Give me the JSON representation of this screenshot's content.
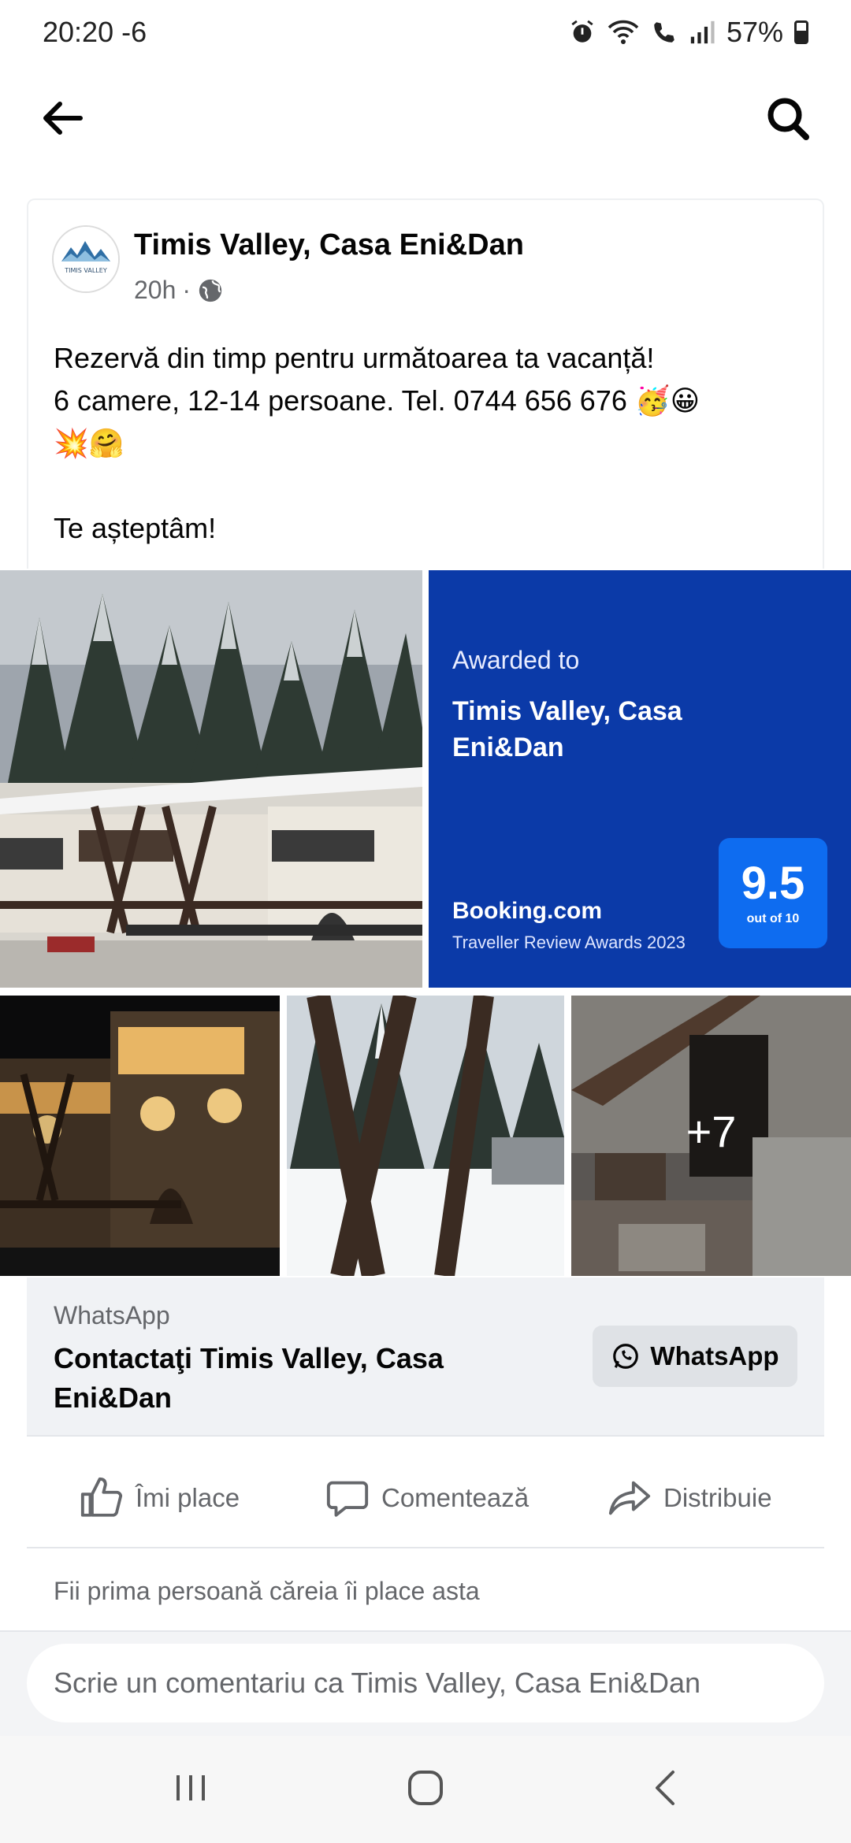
{
  "status_bar": {
    "time": "20:20",
    "extra": "-6",
    "battery": "57%"
  },
  "post": {
    "author": "Timis Valley, Casa Eni&Dan",
    "avatar_text": "TIMIS VALLEY",
    "time": "20h",
    "separator": "·",
    "text_line1": "Rezervă din timp pentru următoarea ta vacanță!",
    "text_line2": "6 camere, 12-14 persoane. Tel. 0744 656 676 🥳😀",
    "text_line3": "💥🤗",
    "text_line4": "Te așteptâm!"
  },
  "award": {
    "label": "Awarded to",
    "name": "Timis Valley, Casa Eni&Dan",
    "brand": "Booking.com",
    "subtitle": "Traveller Review Awards 2023",
    "score": "9.5",
    "score_sub": "out of 10"
  },
  "photos": {
    "more_count": "+7"
  },
  "cta": {
    "source": "WhatsApp",
    "title": "Contactaţi Timis Valley, Casa Eni&Dan",
    "button": "WhatsApp"
  },
  "actions": {
    "like": "Îmi place",
    "comment": "Comentează",
    "share": "Distribuie"
  },
  "likes_text": "Fii prima persoană căreia îi place asta",
  "comment_placeholder": "Scrie un comentariu ca Timis Valley, Casa Eni&Dan",
  "colors": {
    "booking_blue": "#0b3aa8",
    "score_blue": "#0e6cf0",
    "secondary_text": "#65676b"
  }
}
